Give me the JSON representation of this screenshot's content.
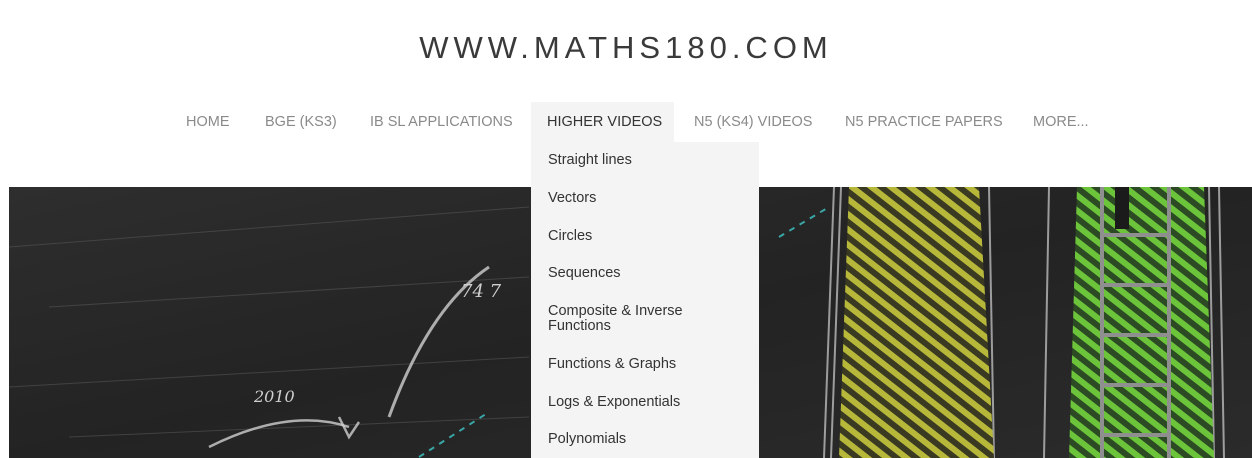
{
  "site": {
    "title": "WWW.MATHS180.COM"
  },
  "nav": {
    "items": [
      {
        "label": "HOME"
      },
      {
        "label": "BGE (KS3)"
      },
      {
        "label": "IB SL APPLICATIONS"
      },
      {
        "label": "HIGHER VIDEOS",
        "active": true
      },
      {
        "label": "N5 (KS4) VIDEOS"
      },
      {
        "label": "N5 PRACTICE PAPERS"
      },
      {
        "label": "MORE..."
      }
    ]
  },
  "dropdown": {
    "items": [
      {
        "label": "Straight lines"
      },
      {
        "label": "Vectors"
      },
      {
        "label": "Circles"
      },
      {
        "label": "Sequences"
      },
      {
        "label": "Composite & Inverse Functions"
      },
      {
        "label": "Functions & Graphs"
      },
      {
        "label": "Logs & Exponentials"
      },
      {
        "label": "Polynomials"
      }
    ]
  },
  "hero": {
    "chalk_text_1": "74 7",
    "chalk_text_2": "2010",
    "colors": {
      "board": "#2a2a2a",
      "yellow_hatch": "#b7b83a",
      "green_hatch": "#6cc43a",
      "ladder": "#8f8f8f"
    }
  }
}
